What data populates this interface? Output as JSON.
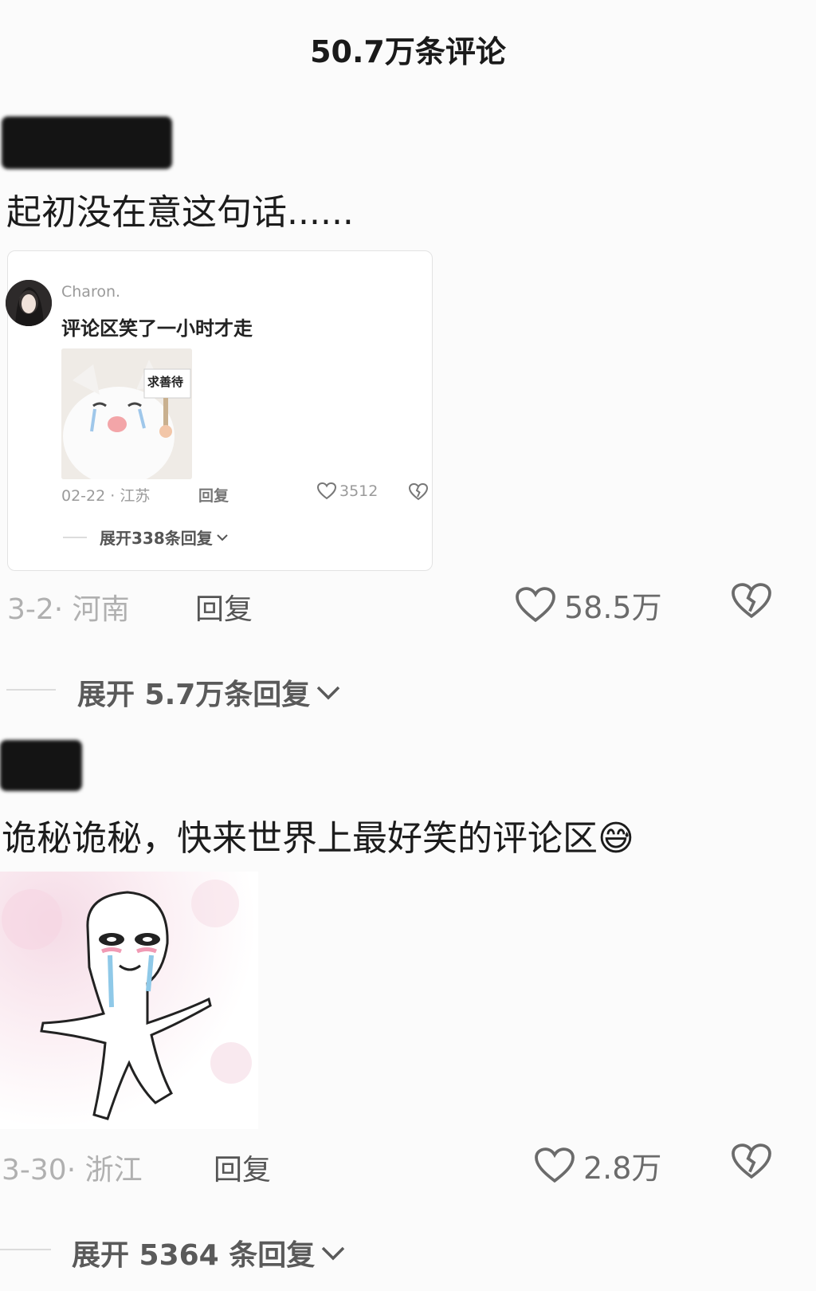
{
  "header": {
    "title": "50.7万条评论"
  },
  "comments": [
    {
      "text": "起初没在意这句话......",
      "quoted": {
        "user": "Charon.",
        "text": "评论区笑了一小时才走",
        "sign_text": "求善待",
        "date_loc": "02-22 · 江苏",
        "reply_label": "回复",
        "likes": "3512",
        "expand_label": "展开338条回复"
      },
      "date_loc": "3-2· 河南",
      "reply_label": "回复",
      "likes": "58.5万",
      "expand_label": "展开 5.7万条回复"
    },
    {
      "text": "诡秘诡秘，快来世界上最好笑的评论区",
      "emoji": "😅",
      "date_loc": "3-30· 浙江",
      "reply_label": "回复",
      "likes": "2.8万",
      "expand_label": "展开 5364 条回复"
    }
  ],
  "icons": {
    "like": "heart-icon",
    "dislike": "broken-heart-icon",
    "expand": "chevron-down-icon"
  }
}
